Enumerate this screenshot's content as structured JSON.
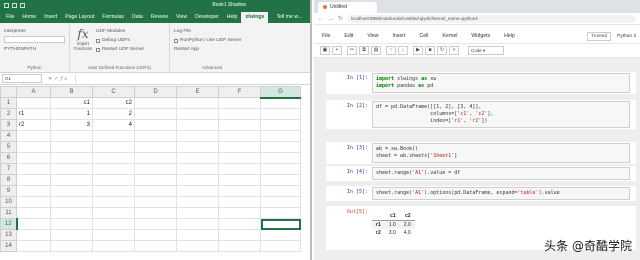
{
  "excel": {
    "title": "Book1 Shadow",
    "tabs": [
      "File",
      "Home",
      "Insert",
      "Page Layout",
      "Formulas",
      "Data",
      "Review",
      "View",
      "Developer",
      "Help",
      "xlwings",
      "Tell me w..."
    ],
    "active_tab": "xlwings",
    "ribbon": {
      "interpreter_label": "Interpreter",
      "pythonpath_label": "PYTHONPATH",
      "python_group": "Python",
      "import_label": "Import Functions",
      "udf_modules_label": "UDF Modules",
      "debug_udfs": "Debug UDFs",
      "restart_udf": "Restart UDF Server",
      "udf_group": "User Defined Functions (UDFs)",
      "log_file": "Log File",
      "run_python_label": "RunPython: Use UDF Server",
      "restart_app": "Restart App",
      "advanced_group": "Advanced"
    },
    "name_box": "G1",
    "columns": [
      "A",
      "B",
      "C",
      "D",
      "E",
      "F",
      "G"
    ],
    "selected_column": "G",
    "rows": [
      {
        "n": "1",
        "cells": [
          "",
          "c1",
          "c2",
          "",
          "",
          "",
          ""
        ]
      },
      {
        "n": "2",
        "cells": [
          "r1",
          "1",
          "2",
          "",
          "",
          "",
          ""
        ]
      },
      {
        "n": "3",
        "cells": [
          "r2",
          "3",
          "4",
          "",
          "",
          "",
          ""
        ]
      },
      {
        "n": "4",
        "cells": [
          "",
          "",
          "",
          "",
          "",
          "",
          ""
        ]
      },
      {
        "n": "5",
        "cells": [
          "",
          "",
          "",
          "",
          "",
          "",
          ""
        ]
      },
      {
        "n": "6",
        "cells": [
          "",
          "",
          "",
          "",
          "",
          "",
          ""
        ]
      },
      {
        "n": "7",
        "cells": [
          "",
          "",
          "",
          "",
          "",
          "",
          ""
        ]
      },
      {
        "n": "8",
        "cells": [
          "",
          "",
          "",
          "",
          "",
          "",
          ""
        ]
      },
      {
        "n": "9",
        "cells": [
          "",
          "",
          "",
          "",
          "",
          "",
          ""
        ]
      },
      {
        "n": "10",
        "cells": [
          "",
          "",
          "",
          "",
          "",
          "",
          ""
        ]
      },
      {
        "n": "11",
        "cells": [
          "",
          "",
          "",
          "",
          "",
          "",
          ""
        ]
      },
      {
        "n": "12",
        "cells": [
          "",
          "",
          "",
          "",
          "",
          "",
          ""
        ]
      },
      {
        "n": "13",
        "cells": [
          "",
          "",
          "",
          "",
          "",
          "",
          ""
        ]
      },
      {
        "n": "14",
        "cells": [
          "",
          "",
          "",
          "",
          "",
          "",
          ""
        ]
      }
    ],
    "selected_row": "12",
    "numeric_columns": [
      1,
      2
    ],
    "accent": "#217346"
  },
  "browser": {
    "tab_title": "Untitled",
    "url": "localhost:8888/notebooks/Untitled.ipynb?kernel_name=python3"
  },
  "jupyter": {
    "menu": [
      "File",
      "Edit",
      "View",
      "Insert",
      "Cell",
      "Kernel",
      "Widgets",
      "Help"
    ],
    "trusted": "Trusted",
    "kernel": "Python 3",
    "cell_type": "Code",
    "toolbar_icons": [
      "save-icon",
      "plus-icon",
      "cut-icon",
      "copy-icon",
      "paste-icon",
      "up-icon",
      "down-icon",
      "run-icon",
      "stop-icon",
      "restart-icon",
      "fast-forward-icon"
    ],
    "cells": [
      {
        "prompt": "In [1]:",
        "lines": [
          "import xlwings as xw",
          "import pandas as pd"
        ]
      },
      {
        "prompt": "In [2]:",
        "lines": [
          "df = pd.DataFrame([[1, 2], [3, 4]],",
          "                  columns=['c1', 'c2'],",
          "                  index=['r1', 'r2'])"
        ]
      },
      {
        "prompt": "In [3]:",
        "lines": [
          "wb = xw.Book()",
          "sheet = wb.sheets['Sheet1']"
        ]
      },
      {
        "prompt": "In [4]:",
        "lines": [
          "sheet.range('A1').value = df"
        ]
      },
      {
        "prompt": "In [5]:",
        "lines": [
          "sheet.range('A1').options(pd.DataFrame, expand='table').value"
        ]
      }
    ],
    "output": {
      "prompt": "Out[5]:",
      "columns": [
        "c1",
        "c2"
      ],
      "rows": [
        {
          "index": "r1",
          "values": [
            "1.0",
            "2.0"
          ]
        },
        {
          "index": "r2",
          "values": [
            "3.0",
            "4.0"
          ]
        }
      ]
    }
  },
  "watermark": {
    "text": "头条 @奇酷学院"
  }
}
